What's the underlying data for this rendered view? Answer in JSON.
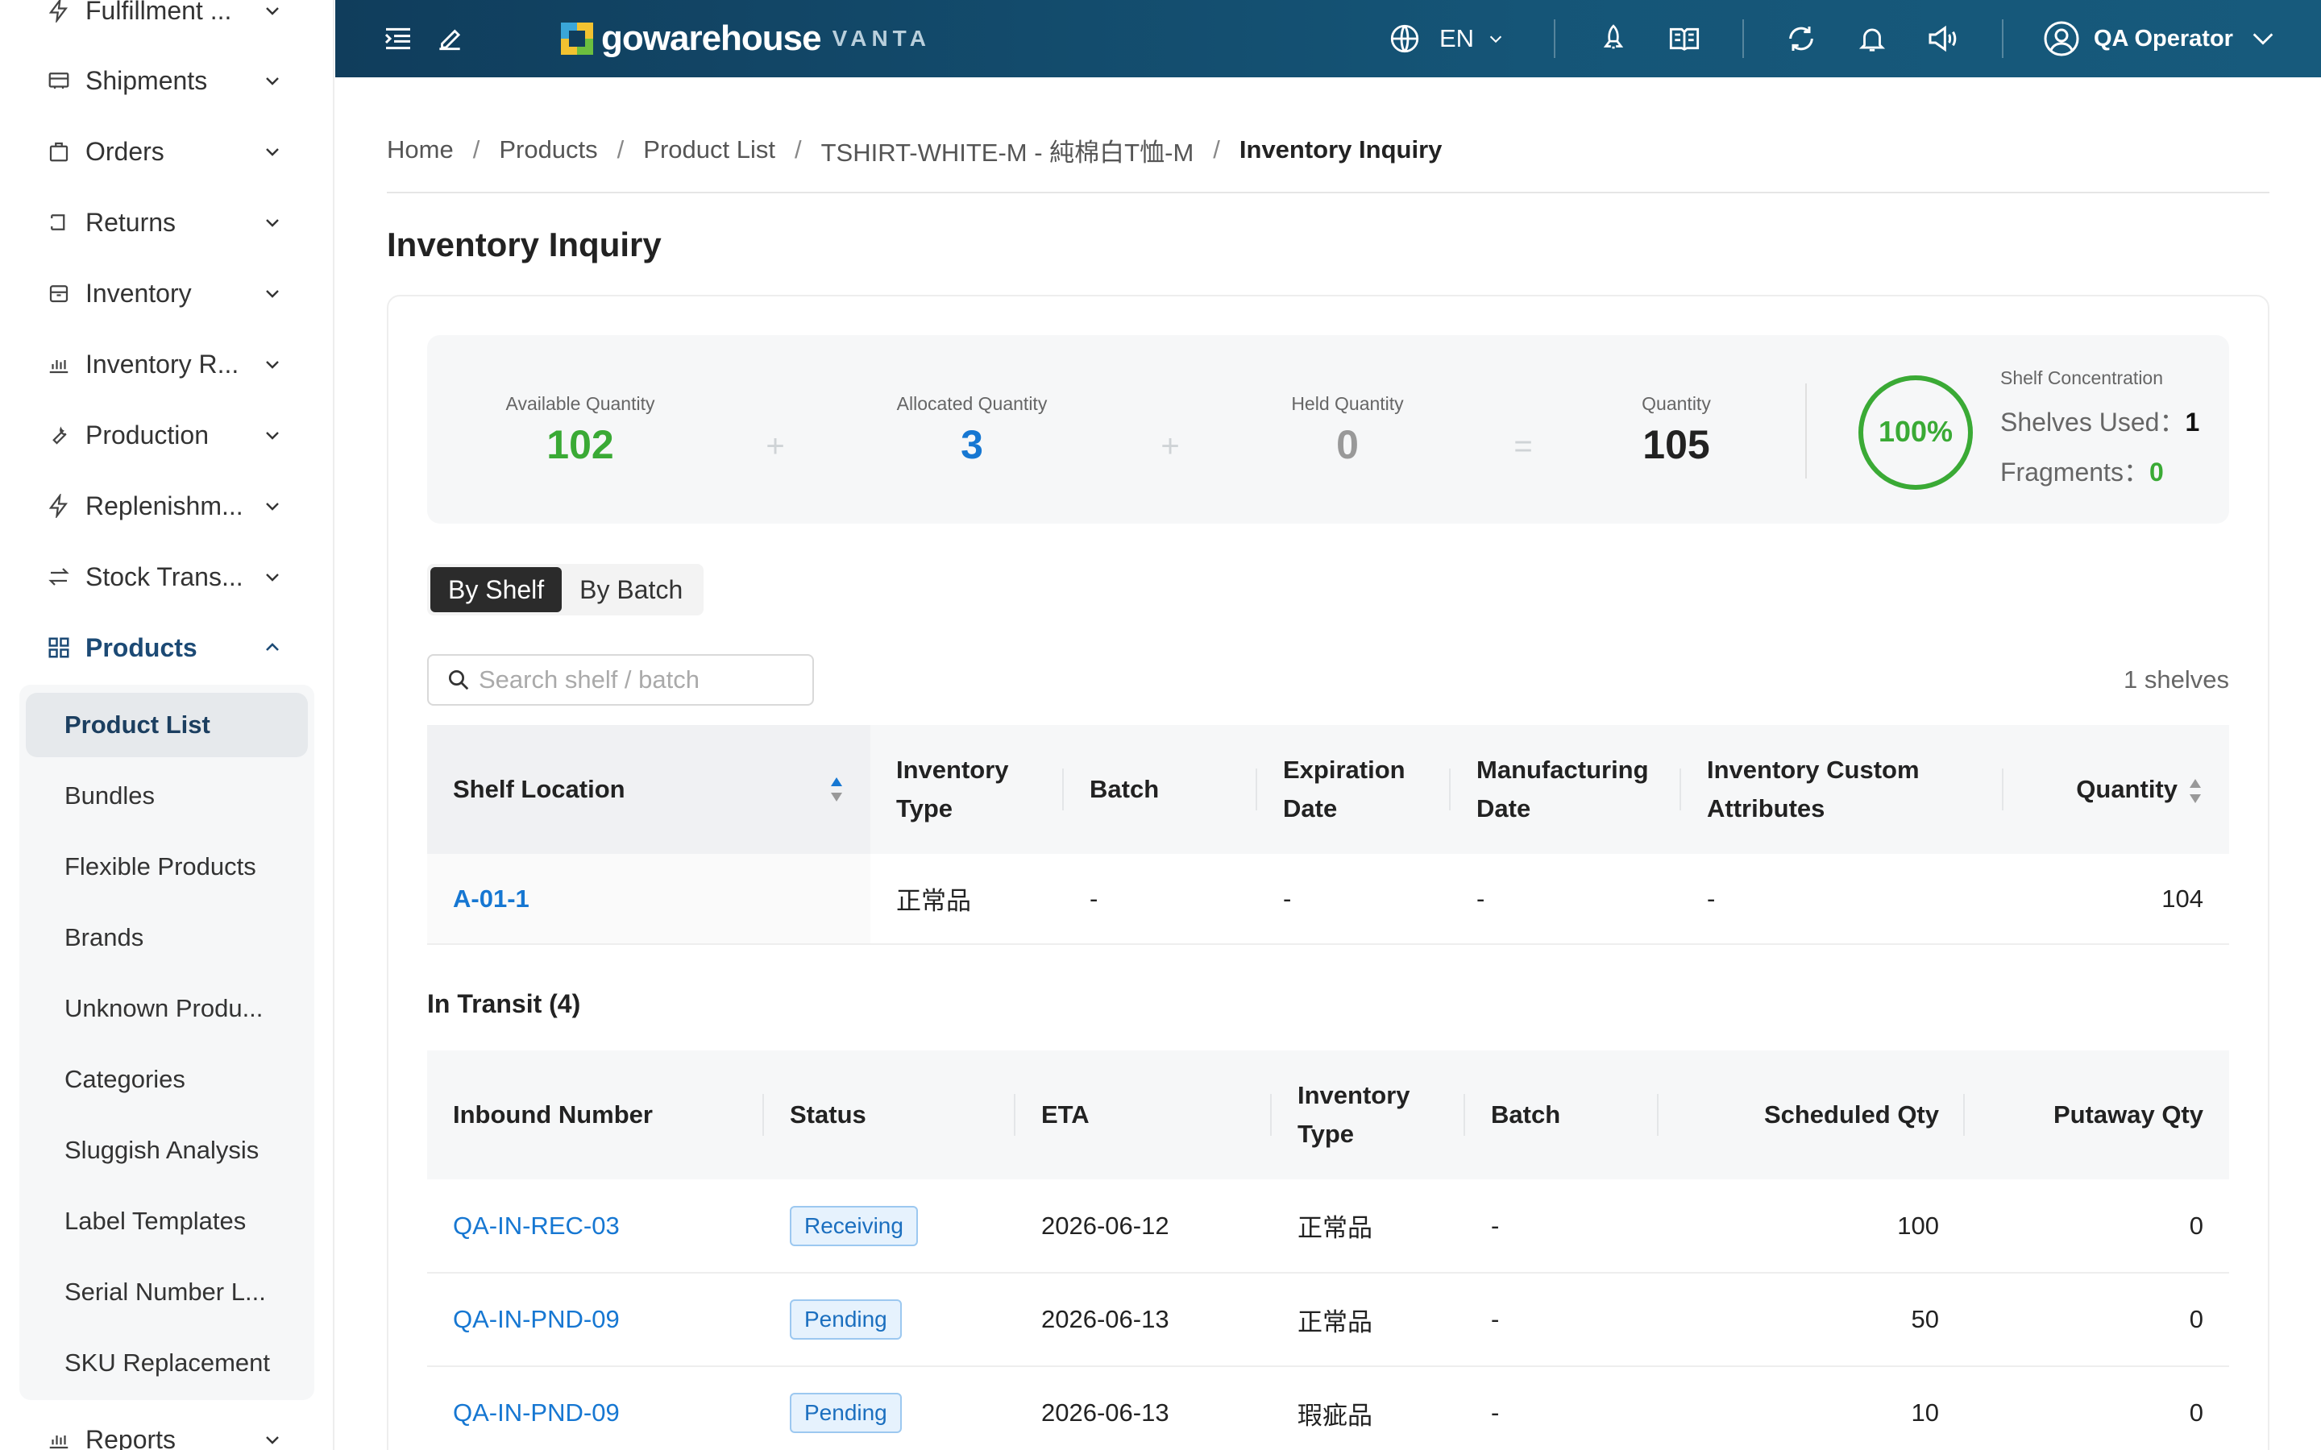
{
  "sidebar": {
    "items": [
      {
        "label": "Fulfillment ...",
        "icon": "lightning-icon"
      },
      {
        "label": "Shipments",
        "icon": "truck-icon"
      },
      {
        "label": "Orders",
        "icon": "shopping-bag-icon"
      },
      {
        "label": "Returns",
        "icon": "return-icon"
      },
      {
        "label": "Inventory",
        "icon": "inventory-box-icon"
      },
      {
        "label": "Inventory R...",
        "icon": "bar-chart-icon"
      },
      {
        "label": "Production",
        "icon": "wrench-icon"
      },
      {
        "label": "Replenishm...",
        "icon": "lightning-icon"
      },
      {
        "label": "Stock Trans...",
        "icon": "transfer-icon"
      },
      {
        "label": "Products",
        "icon": "grid-icon"
      },
      {
        "label": "Reports",
        "icon": "bar-chart-icon"
      }
    ],
    "products_sub": [
      "Product List",
      "Bundles",
      "Flexible Products",
      "Brands",
      "Unknown Produ...",
      "Categories",
      "Sluggish Analysis",
      "Label Templates",
      "Serial Number L...",
      "SKU Replacement"
    ]
  },
  "header": {
    "logo_text": "gowarehouse",
    "logo_sub": "VANTA",
    "lang": "EN",
    "user": "QA Operator"
  },
  "breadcrumb": [
    "Home",
    "Products",
    "Product List",
    "TSHIRT-WHITE-M - 純棉白T恤-M",
    "Inventory Inquiry"
  ],
  "page_title": "Inventory Inquiry",
  "summary": {
    "available_label": "Available Quantity",
    "available": "102",
    "allocated_label": "Allocated Quantity",
    "allocated": "3",
    "held_label": "Held Quantity",
    "held": "0",
    "quantity_label": "Quantity",
    "quantity": "105",
    "plus": "+",
    "equals": "=",
    "concentration_pct": "100%",
    "concentration_value": 1.0,
    "concentration_label": "Shelf Concentration",
    "shelves_used_label": "Shelves Used：",
    "shelves_used": "1",
    "fragments_label": "Fragments：",
    "fragments": "0"
  },
  "tabs": {
    "by_shelf": "By Shelf",
    "by_batch": "By Batch"
  },
  "search": {
    "placeholder": "Search shelf / batch"
  },
  "shelf_count": "1 shelves",
  "shelf_table": {
    "headers": [
      "Shelf Location",
      "Inventory Type",
      "Batch",
      "Expiration Date",
      "Manufacturing Date",
      "Inventory Custom Attributes",
      "Quantity"
    ],
    "rows": [
      {
        "location": "A-01-1",
        "type": "正常品",
        "batch": "-",
        "exp": "-",
        "mfg": "-",
        "attrs": "-",
        "qty": "104"
      }
    ]
  },
  "in_transit": {
    "title": "In Transit (4)",
    "headers": [
      "Inbound Number",
      "Status",
      "ETA",
      "Inventory Type",
      "Batch",
      "Scheduled Qty",
      "Putaway Qty"
    ],
    "rows": [
      {
        "number": "QA-IN-REC-03",
        "status": "Receiving",
        "eta": "2026-06-12",
        "type": "正常品",
        "batch": "-",
        "scheduled": "100",
        "putaway": "0"
      },
      {
        "number": "QA-IN-PND-09",
        "status": "Pending",
        "eta": "2026-06-13",
        "type": "正常品",
        "batch": "-",
        "scheduled": "50",
        "putaway": "0"
      },
      {
        "number": "QA-IN-PND-09",
        "status": "Pending",
        "eta": "2026-06-13",
        "type": "瑕疵品",
        "batch": "-",
        "scheduled": "10",
        "putaway": "0"
      }
    ]
  },
  "colors": {
    "header_bg": "#114060",
    "accent_green": "#3aaa35",
    "accent_blue": "#1677d2",
    "muted": "#999999",
    "active_nav": "#1c4a75"
  }
}
